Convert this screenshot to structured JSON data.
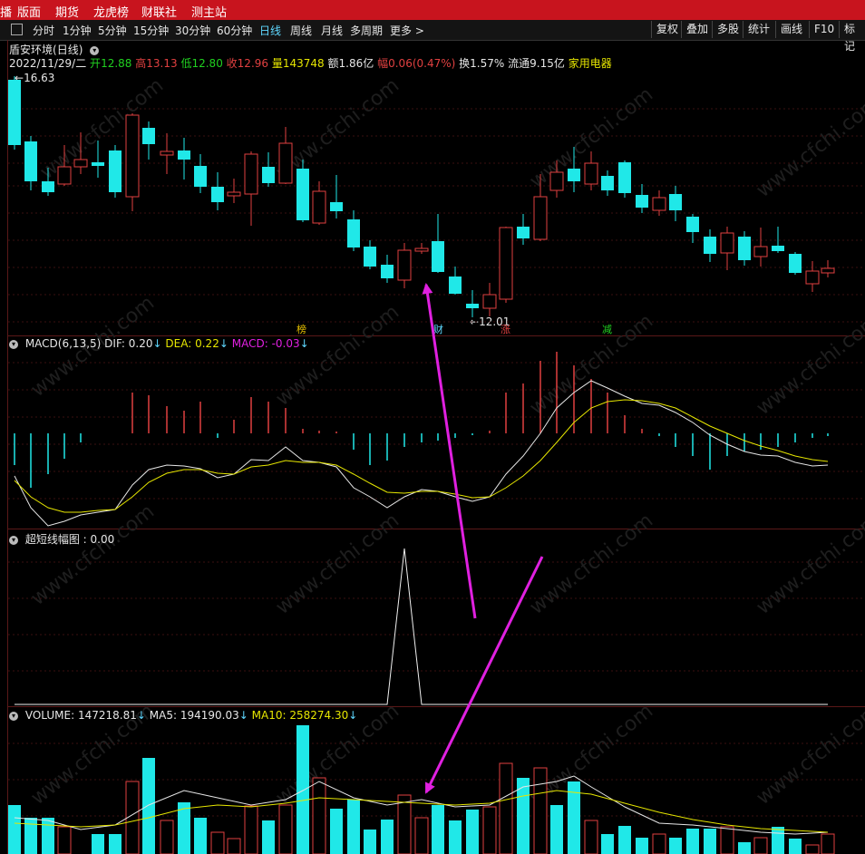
{
  "menubar": {
    "left_cut": "播",
    "items": [
      "版面",
      "期货",
      "龙虎榜",
      "财联社",
      "测主站"
    ]
  },
  "toolbar": {
    "timeframes": [
      "分时",
      "1分钟",
      "5分钟",
      "15分钟",
      "30分钟",
      "60分钟",
      "日线",
      "周线",
      "月线",
      "多周期",
      "更多 >"
    ],
    "active": "日线",
    "right_buttons": [
      "复权",
      "叠加",
      "多股",
      "统计",
      "画线",
      "F10",
      "标记"
    ]
  },
  "stock": {
    "name": "盾安环境",
    "period": "(日线)",
    "date": "2022/11/29/二",
    "open_label": "开",
    "open": "12.88",
    "high_label": "高",
    "high": "13.13",
    "low_label": "低",
    "low": "12.80",
    "close_label": "收",
    "close": "12.96",
    "volume_label": "量",
    "volume": "143748",
    "amount_label": "额",
    "amount": "1.86亿",
    "change_label": "幅",
    "change": "0.06(0.47%)",
    "turnover_label": "换",
    "turnover": "1.57%",
    "float_label": "流通",
    "float": "9.15亿",
    "industry": "家用电器"
  },
  "price_panel": {
    "high_marker": "16.63",
    "low_marker": "12.01",
    "tags": [
      "榜",
      "财",
      "涨",
      "减"
    ]
  },
  "macd_panel": {
    "name": "MACD(6,13,5)",
    "dif_label": "DIF:",
    "dif": "0.20",
    "dea_label": "DEA:",
    "dea": "0.22",
    "macd_label": "MACD:",
    "macd": "-0.03"
  },
  "ultra_panel": {
    "name": "超短线幅图",
    "value": ": 0.00"
  },
  "volume_panel": {
    "name": "VOLUME:",
    "value": "147218.81",
    "ma5_label": "MA5:",
    "ma5": "194190.03",
    "ma10_label": "MA10:",
    "ma10": "258274.30"
  },
  "watermark": "www.cfchi.com",
  "colors": {
    "up": "#e04040",
    "down": "#20e8e8",
    "menubar": "#c8141e",
    "arrow": "#e020e0",
    "ma_yellow": "#e6e600"
  }
}
